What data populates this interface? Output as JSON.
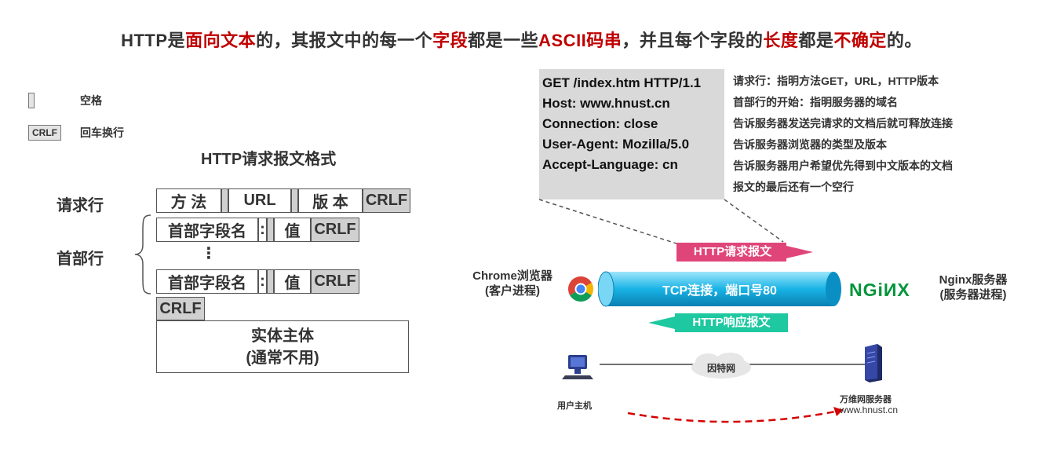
{
  "title": {
    "seg1": "HTTP是",
    "seg2": "面向文本",
    "seg3": "的，其报文中的每一个",
    "seg4": "字段",
    "seg5": "都是一些",
    "seg6": "ASCII码串",
    "seg7": "，并且每个字段的",
    "seg8": "长度",
    "seg9": "都是",
    "seg10": "不确定",
    "seg11": "的。"
  },
  "legend": {
    "space_label": "空格",
    "crlf_symbol": "CRLF",
    "crlf_label": "回车换行"
  },
  "format": {
    "title": "HTTP请求报文格式",
    "request_line_label": "请求行",
    "header_lines_label": "首部行",
    "method": "方 法",
    "url": "URL",
    "version": "版 本",
    "crlf": "CRLF",
    "field_name": "首部字段名",
    "colon": ":",
    "value": "值",
    "ellipsis": "⋮",
    "body_line1": "实体主体",
    "body_line2": "(通常不用)"
  },
  "request_example": {
    "lines": [
      "GET /index.htm HTTP/1.1",
      "Host: www.hnust.cn",
      "Connection: close",
      "User-Agent:  Mozilla/5.0",
      "Accept-Language: cn"
    ],
    "notes": [
      "请求行：指明方法GET，URL，HTTP版本",
      "首部行的开始：指明服务器的域名",
      "告诉服务器发送完请求的文档后就可释放连接",
      "告诉服务器浏览器的类型及版本",
      "告诉服务器用户希望优先得到中文版本的文档",
      "报文的最后还有一个空行"
    ]
  },
  "flow": {
    "client_line1": "Chrome浏览器",
    "client_line2": "(客户进程)",
    "server_logo": "NGiИX",
    "server_line1": "Nginx服务器",
    "server_line2": "(服务器进程)",
    "request_arrow": "HTTP请求报文",
    "tcp_label": "TCP连接，端口号80",
    "response_arrow": "HTTP响应报文",
    "host_label": "用户主机",
    "internet_label": "因特网",
    "web_server_label": "万维网服务器",
    "web_server_domain": "www.hnust.cn"
  },
  "colors": {
    "highlight": "#c00000",
    "request_arrow": "#e0457a",
    "response_arrow": "#1ec8a0",
    "tcp_pipe": "#19b3e6",
    "nginx": "#009639",
    "dashed_path": "#d40000"
  }
}
